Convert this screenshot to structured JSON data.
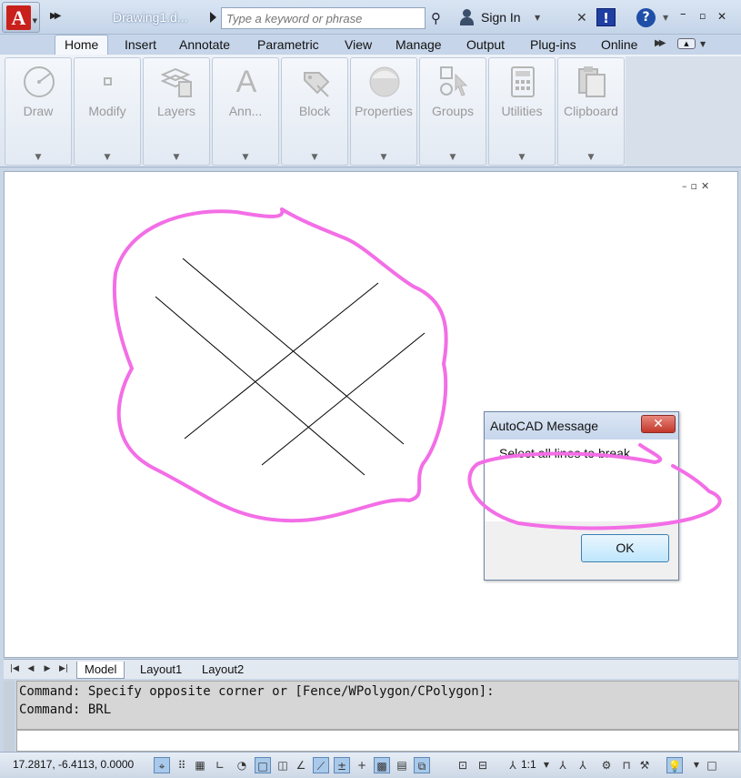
{
  "titlebar": {
    "app_logo": "A",
    "document_title": "Drawing1.d...",
    "search_placeholder": "Type a keyword or phrase",
    "signin_label": "Sign In",
    "info_icon_label": "!",
    "help_icon_label": "?"
  },
  "ribbon": {
    "tabs": [
      {
        "label": "Home",
        "active": true
      },
      {
        "label": "Insert"
      },
      {
        "label": "Annotate"
      },
      {
        "label": "Parametric"
      },
      {
        "label": "View"
      },
      {
        "label": "Manage"
      },
      {
        "label": "Output"
      },
      {
        "label": "Plug-ins"
      },
      {
        "label": "Online"
      }
    ],
    "panels": [
      {
        "label": "Draw",
        "icon": "draw-icon"
      },
      {
        "label": "Modify",
        "icon": "modify-icon"
      },
      {
        "label": "Layers",
        "icon": "layers-icon"
      },
      {
        "label": "Ann...",
        "icon": "annotation-icon",
        "glyph": "A"
      },
      {
        "label": "Block",
        "icon": "block-icon"
      },
      {
        "label": "Properties",
        "icon": "properties-icon"
      },
      {
        "label": "Groups",
        "icon": "groups-icon"
      },
      {
        "label": "Utilities",
        "icon": "utilities-icon"
      },
      {
        "label": "Clipboard",
        "icon": "clipboard-icon"
      }
    ]
  },
  "dialog": {
    "title": "AutoCAD Message",
    "close_label": "✕",
    "message": "Select all lines to break",
    "ok_label": "OK"
  },
  "layout_tabs": [
    {
      "label": "Model",
      "active": true
    },
    {
      "label": "Layout1"
    },
    {
      "label": "Layout2"
    }
  ],
  "command_line": {
    "history": [
      "Command: Specify opposite corner or [Fence/WPolygon/CPolygon]:",
      "Command: BRL"
    ],
    "input": ""
  },
  "statusbar": {
    "coordinates": "17.2817, -6.4113, 0.0000",
    "annotation_scale": "1:1"
  },
  "colors": {
    "annotation": "#f36ee6",
    "accent": "#1f4fa8",
    "close_button": "#c2382a"
  }
}
